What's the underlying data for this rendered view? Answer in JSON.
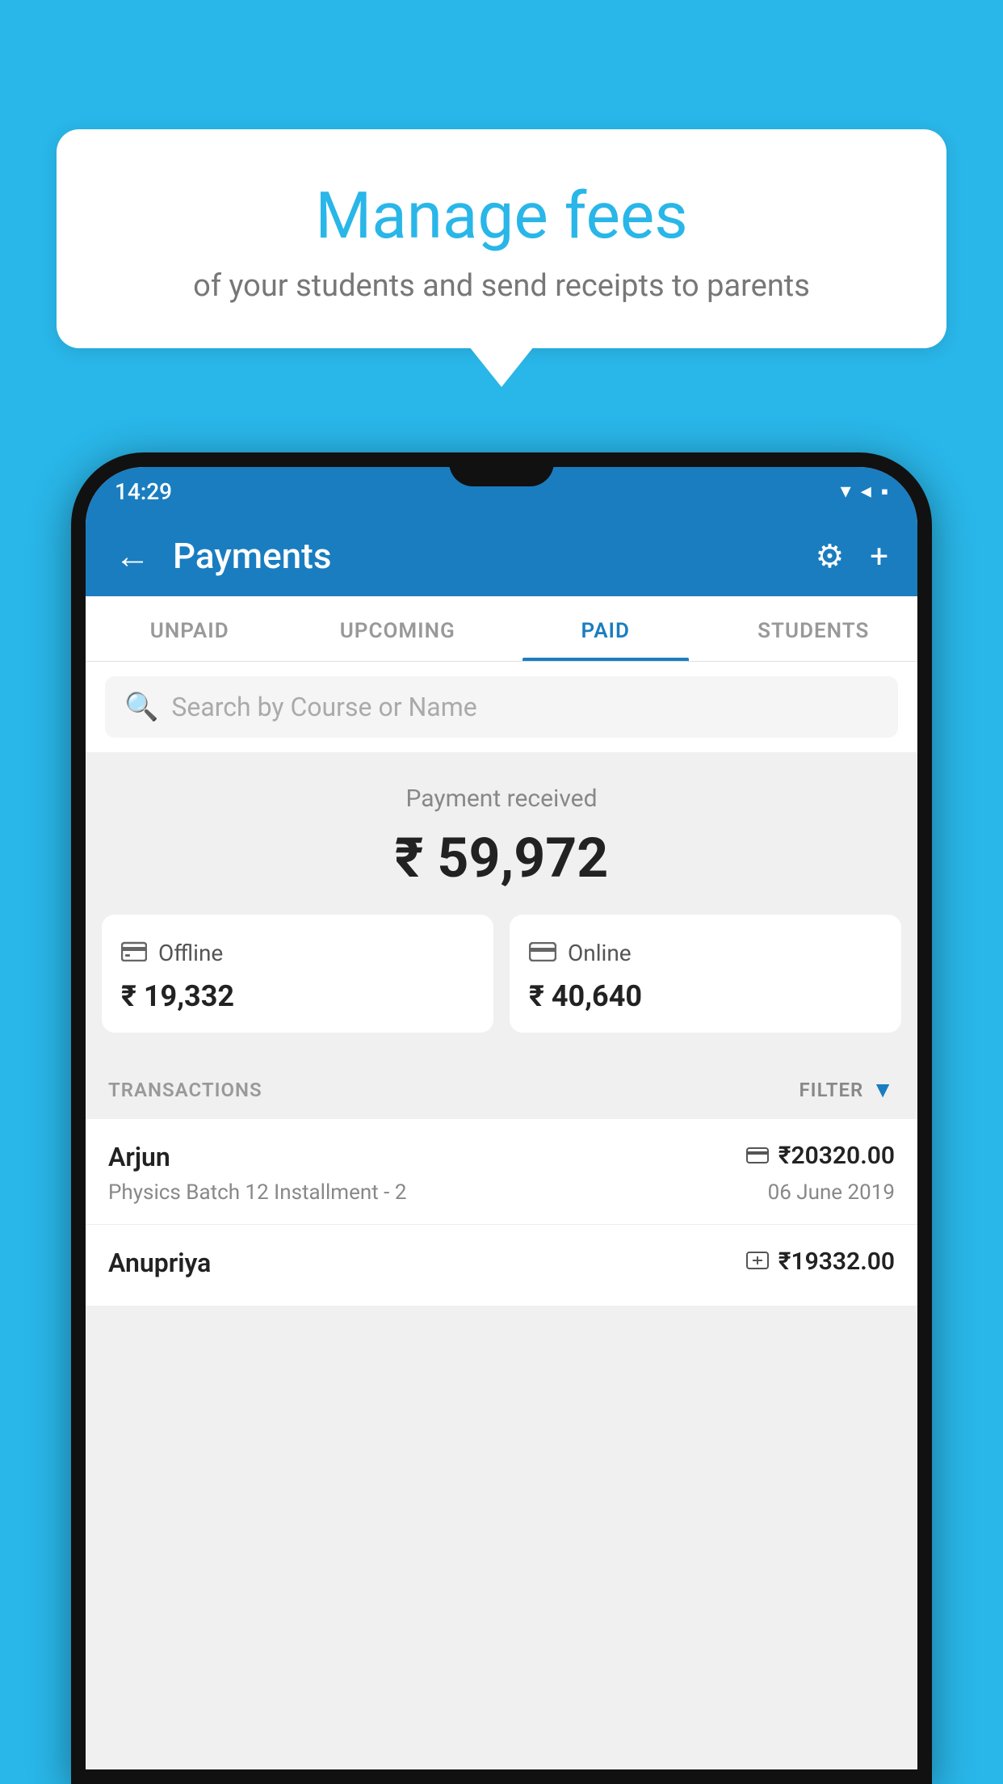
{
  "background_color": "#29b6e8",
  "bubble": {
    "title": "Manage fees",
    "subtitle": "of your students and send receipts to parents"
  },
  "status_bar": {
    "time": "14:29",
    "icons": [
      "▾◂▪"
    ]
  },
  "app_bar": {
    "title": "Payments",
    "back_icon": "←",
    "settings_icon": "⚙",
    "add_icon": "+"
  },
  "tabs": [
    {
      "label": "UNPAID",
      "active": false
    },
    {
      "label": "UPCOMING",
      "active": false
    },
    {
      "label": "PAID",
      "active": true
    },
    {
      "label": "STUDENTS",
      "active": false
    }
  ],
  "search": {
    "placeholder": "Search by Course or Name"
  },
  "payment_summary": {
    "label": "Payment received",
    "amount": "₹ 59,972",
    "offline": {
      "icon": "🪙",
      "label": "Offline",
      "amount": "₹ 19,332"
    },
    "online": {
      "icon": "💳",
      "label": "Online",
      "amount": "₹ 40,640"
    }
  },
  "transactions": {
    "label": "TRANSACTIONS",
    "filter_label": "FILTER",
    "rows": [
      {
        "name": "Arjun",
        "amount": "₹20320.00",
        "course": "Physics Batch 12 Installment - 2",
        "date": "06 June 2019",
        "payment_type": "online"
      },
      {
        "name": "Anupriya",
        "amount": "₹19332.00",
        "course": "",
        "date": "",
        "payment_type": "offline"
      }
    ]
  }
}
